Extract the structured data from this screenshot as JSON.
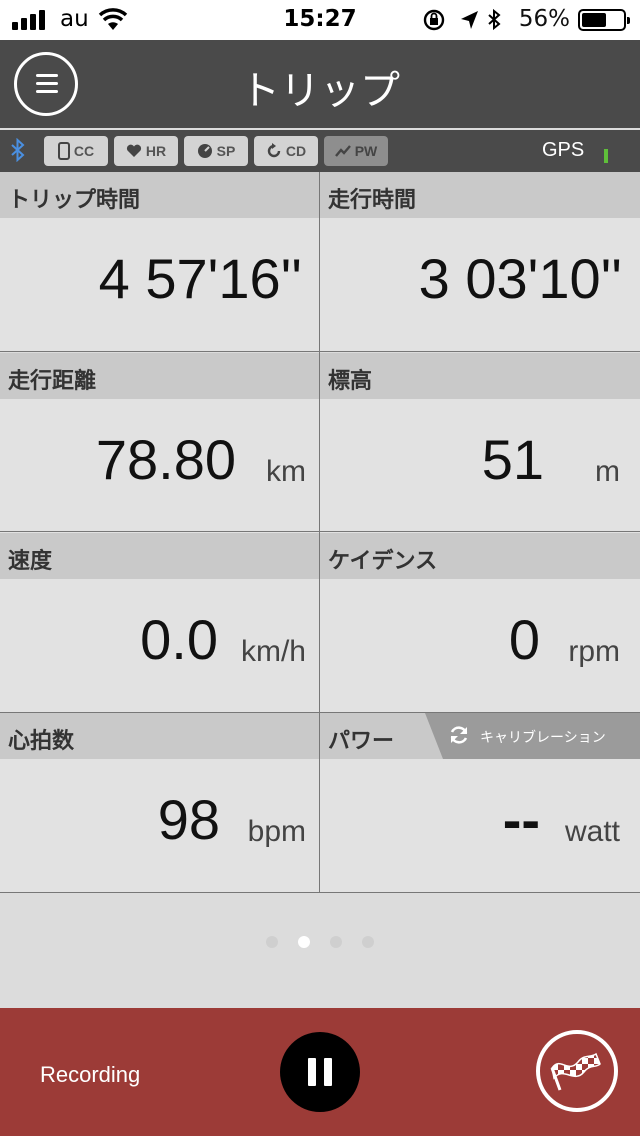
{
  "status": {
    "carrier": "au",
    "time": "15:27",
    "battery_pct": "56%",
    "icons": [
      "signal-icon",
      "wifi-icon",
      "rotation-lock-icon",
      "location-arrow-icon",
      "bluetooth-icon",
      "battery-icon"
    ]
  },
  "header": {
    "title": "トリップ"
  },
  "sensors": {
    "chips": [
      {
        "label": "CC",
        "icon": "phone-icon",
        "active": true
      },
      {
        "label": "HR",
        "icon": "heart-icon",
        "active": true
      },
      {
        "label": "SP",
        "icon": "speed-icon",
        "active": true
      },
      {
        "label": "CD",
        "icon": "cadence-icon",
        "active": true
      },
      {
        "label": "PW",
        "icon": "power-icon",
        "active": false
      }
    ],
    "gps_label": "GPS",
    "bluetooth_color": "#4a90e2"
  },
  "cells": [
    {
      "label": "トリップ時間",
      "value": "4 57'16''",
      "unit": ""
    },
    {
      "label": "走行時間",
      "value": "3 03'10''",
      "unit": ""
    },
    {
      "label": "走行距離",
      "value": "78.80",
      "unit": "km"
    },
    {
      "label": "標高",
      "value": "51",
      "unit": "m"
    },
    {
      "label": "速度",
      "value": "0.0",
      "unit": "km/h"
    },
    {
      "label": "ケイデンス",
      "value": "0",
      "unit": "rpm"
    },
    {
      "label": "心拍数",
      "value": "98",
      "unit": "bpm"
    },
    {
      "label": "パワー",
      "value": "--",
      "unit": "watt"
    }
  ],
  "calibration_label": "キャリブレーション",
  "pager": {
    "count": 4,
    "active": 1
  },
  "footer": {
    "recording_label": "Recording",
    "accent_color": "#9c3b37"
  }
}
